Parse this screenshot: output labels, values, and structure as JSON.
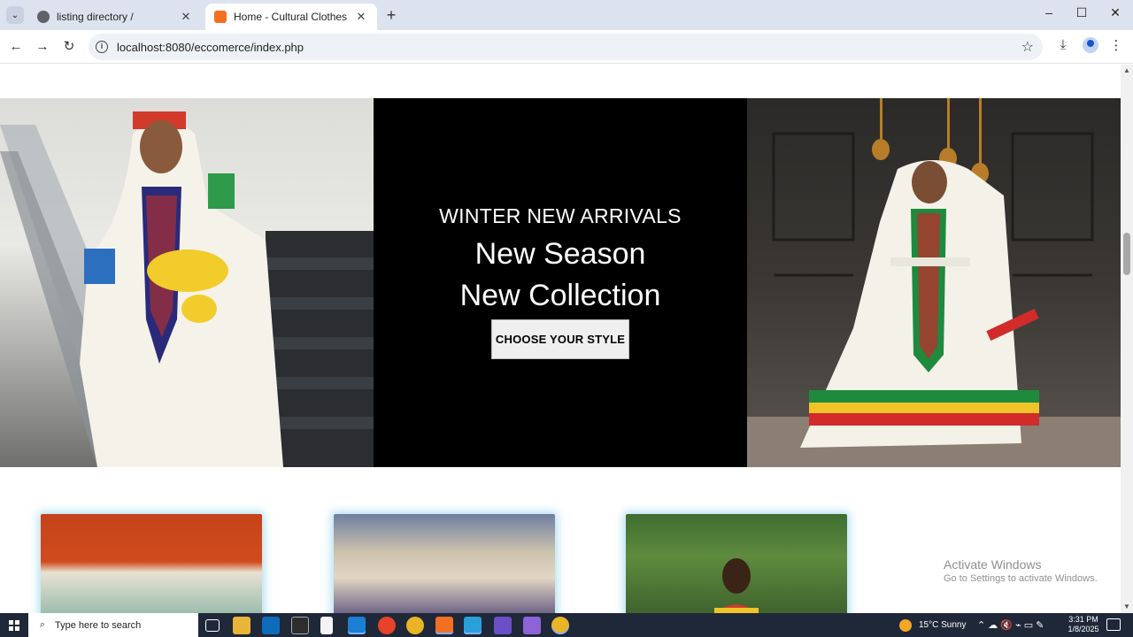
{
  "browser": {
    "tabs": [
      {
        "title": "listing directory /",
        "favicon": "globe-icon",
        "active": false
      },
      {
        "title": "Home - Cultural Clothes",
        "favicon": "xampp-icon",
        "active": true
      }
    ],
    "new_tab": "+",
    "url": "localhost:8080/eccomerce/index.php",
    "window_controls": {
      "minimize": "–",
      "maximize": "☐",
      "close": "✕"
    }
  },
  "hero": {
    "kicker": "WINTER NEW ARRIVALS",
    "headline_1": "New Season",
    "headline_2": "New Collection",
    "cta": "CHOOSE YOUR STYLE"
  },
  "watermark": {
    "title": "Activate Windows",
    "subtitle": "Go to Settings to activate Windows."
  },
  "taskbar": {
    "search_placeholder": "Type here to search",
    "weather": "15°C  Sunny",
    "time": "3:31 PM",
    "date": "1/8/2025"
  },
  "colors": {
    "tabstrip": "#dde3ee",
    "hero_mid": "#000000",
    "button_bg": "#efefef",
    "card_glow": "#78c8e6",
    "taskbar": "#1f2838"
  }
}
